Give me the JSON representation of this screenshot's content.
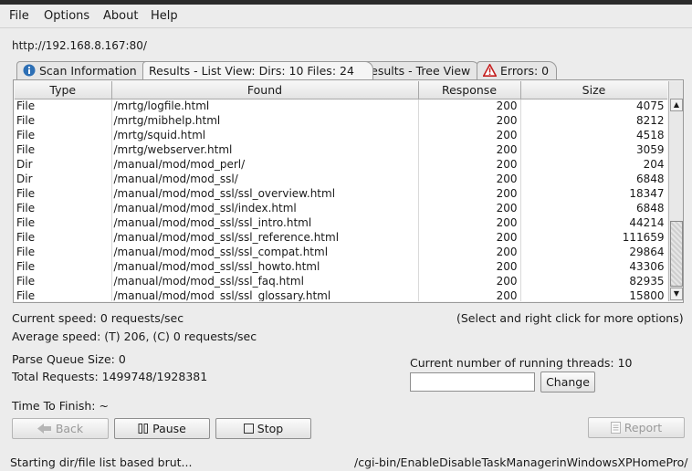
{
  "menu": {
    "file": "File",
    "options": "Options",
    "about": "About",
    "help": "Help"
  },
  "target_url": "http://192.168.8.167:80/",
  "tabs": {
    "scan_info": "Scan Information",
    "list_view": "Results - List View: Dirs: 10 Files: 24",
    "tree_view": "Results - Tree View",
    "errors": "Errors: 0"
  },
  "table": {
    "columns": [
      "Type",
      "Found",
      "Response",
      "Size"
    ],
    "rows": [
      {
        "type": "File",
        "found": "/mrtg/logfile.html",
        "response": "200",
        "size": "4075"
      },
      {
        "type": "File",
        "found": "/mrtg/mibhelp.html",
        "response": "200",
        "size": "8212"
      },
      {
        "type": "File",
        "found": "/mrtg/squid.html",
        "response": "200",
        "size": "4518"
      },
      {
        "type": "File",
        "found": "/mrtg/webserver.html",
        "response": "200",
        "size": "3059"
      },
      {
        "type": "Dir",
        "found": "/manual/mod/mod_perl/",
        "response": "200",
        "size": "204"
      },
      {
        "type": "Dir",
        "found": "/manual/mod/mod_ssl/",
        "response": "200",
        "size": "6848"
      },
      {
        "type": "File",
        "found": "/manual/mod/mod_ssl/ssl_overview.html",
        "response": "200",
        "size": "18347"
      },
      {
        "type": "File",
        "found": "/manual/mod/mod_ssl/index.html",
        "response": "200",
        "size": "6848"
      },
      {
        "type": "File",
        "found": "/manual/mod/mod_ssl/ssl_intro.html",
        "response": "200",
        "size": "44214"
      },
      {
        "type": "File",
        "found": "/manual/mod/mod_ssl/ssl_reference.html",
        "response": "200",
        "size": "111659"
      },
      {
        "type": "File",
        "found": "/manual/mod/mod_ssl/ssl_compat.html",
        "response": "200",
        "size": "29864"
      },
      {
        "type": "File",
        "found": "/manual/mod/mod_ssl/ssl_howto.html",
        "response": "200",
        "size": "43306"
      },
      {
        "type": "File",
        "found": "/manual/mod/mod_ssl/ssl_faq.html",
        "response": "200",
        "size": "82935"
      },
      {
        "type": "File",
        "found": "/manual/mod/mod_ssl/ssl_glossary.html",
        "response": "200",
        "size": "15800"
      }
    ]
  },
  "stats": {
    "current_speed": "Current speed: 0 requests/sec",
    "hint": "(Select and right click for more options)",
    "average_speed": "Average speed: (T) 206, (C) 0 requests/sec",
    "parse_queue": "Parse Queue Size: 0",
    "total_requests": "Total Requests: 1499748/1928381",
    "running_threads": "Current number of running threads: 10",
    "time_to_finish": "Time To Finish: ~"
  },
  "threads_input_value": "",
  "buttons": {
    "change": "Change",
    "back": "Back",
    "pause": "Pause",
    "stop": "Stop",
    "report": "Report"
  },
  "status": {
    "left": "Starting dir/file list based brut...",
    "right": "/cgi-bin/EnableDisableTaskManagerinWindowsXPHomePro/"
  },
  "colors": {
    "info_icon": "#2d6fb5",
    "error_icon": "#c41f1f"
  }
}
